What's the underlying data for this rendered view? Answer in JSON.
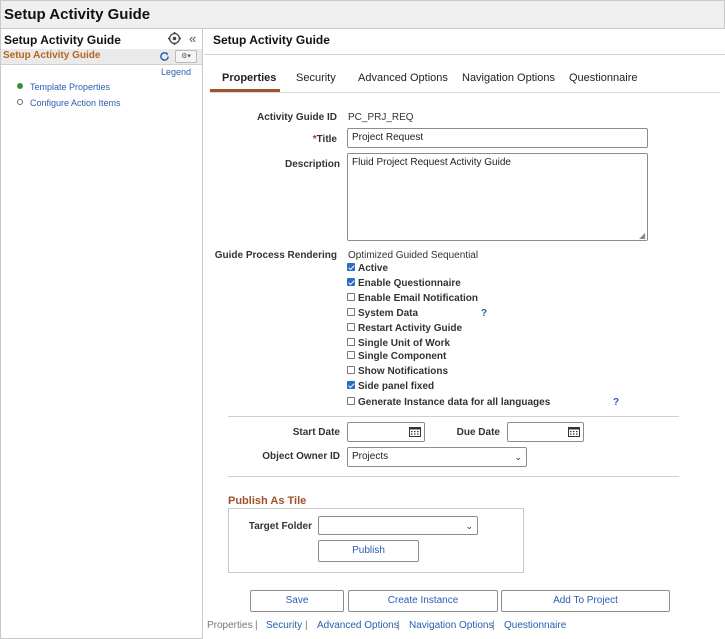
{
  "app": {
    "title": "Setup Activity Guide"
  },
  "side": {
    "title": "Setup Activity Guide",
    "guide_name": "Setup Activity Guide",
    "legend": "Legend",
    "steps": [
      {
        "label": "Template Properties",
        "status": "current"
      },
      {
        "label": "Configure Action Items",
        "status": "not-started"
      }
    ]
  },
  "main": {
    "title": "Setup Activity Guide",
    "tabs": [
      "Properties",
      "Security",
      "Advanced Options",
      "Navigation Options",
      "Questionnaire"
    ],
    "active_tab": "Properties"
  },
  "form": {
    "id_label": "Activity Guide ID",
    "id_value": "PC_PRJ_REQ",
    "title_req": "*",
    "title_label": "Title",
    "title_value": "Project Request",
    "desc_label": "Description",
    "desc_value": "Fluid Project Request Activity Guide",
    "rendering_label": "Guide Process Rendering",
    "rendering_value": "Optimized Guided Sequential",
    "checkboxes": [
      {
        "label": "Active",
        "checked": true
      },
      {
        "label": "Enable Questionnaire",
        "checked": true
      },
      {
        "label": "Enable Email Notification",
        "checked": false
      },
      {
        "label": "System Data",
        "checked": false
      },
      {
        "label": "Restart Activity Guide",
        "checked": false
      },
      {
        "label": "Single Unit of Work",
        "checked": false
      },
      {
        "label": "Single Component",
        "checked": false
      },
      {
        "label": "Show Notifications",
        "checked": false
      },
      {
        "label": "Side panel fixed",
        "checked": true
      },
      {
        "label": "Generate Instance data for all languages",
        "checked": false
      }
    ],
    "help_mark": "?",
    "start_label": "Start Date",
    "start_value": "",
    "due_label": "Due Date",
    "due_value": "",
    "owner_label": "Object Owner ID",
    "owner_value": "Projects"
  },
  "tile": {
    "header": "Publish As Tile",
    "folder_label": "Target Folder",
    "folder_value": "",
    "publish": "Publish"
  },
  "actions": {
    "save": "Save",
    "create_instance": "Create Instance",
    "add_to_project": "Add To Project"
  },
  "footer": {
    "links": [
      "Properties",
      "Security",
      "Advanced Options",
      "Navigation Options",
      "Questionnaire"
    ],
    "separator": "|"
  },
  "colors": {
    "accent": "#a0522d",
    "link": "#2a5db0",
    "check": "#2b6cc4",
    "step_done": "#3a8f3a"
  }
}
